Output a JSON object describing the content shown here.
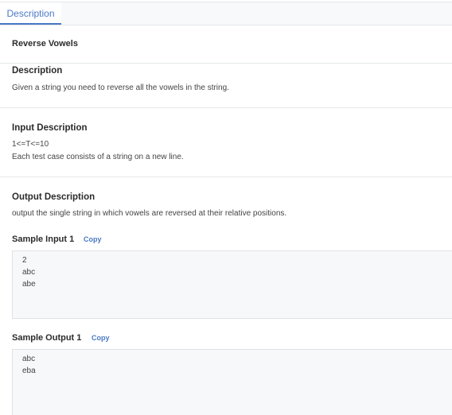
{
  "tabs": [
    {
      "label": "Description",
      "active": true
    }
  ],
  "problem": {
    "title": "Reverse Vowels"
  },
  "description": {
    "heading": "Description",
    "text": "Given a string you need to reverse all the vowels in the string."
  },
  "input_description": {
    "heading": "Input Description",
    "lines": [
      "1<=T<=10",
      "Each test case consists of a string on a new line."
    ]
  },
  "output_description": {
    "heading": "Output Description",
    "text": "output the single string in which vowels are reversed at their relative positions."
  },
  "sample_input": {
    "heading": "Sample Input 1",
    "copy_label": "Copy",
    "lines": [
      "2",
      "abc",
      "abe"
    ]
  },
  "sample_output": {
    "heading": "Sample Output 1",
    "copy_label": "Copy",
    "lines": [
      "abc",
      "eba"
    ]
  },
  "colors": {
    "accent": "#4a79c5",
    "sample_bg": "#f7f8fa"
  }
}
